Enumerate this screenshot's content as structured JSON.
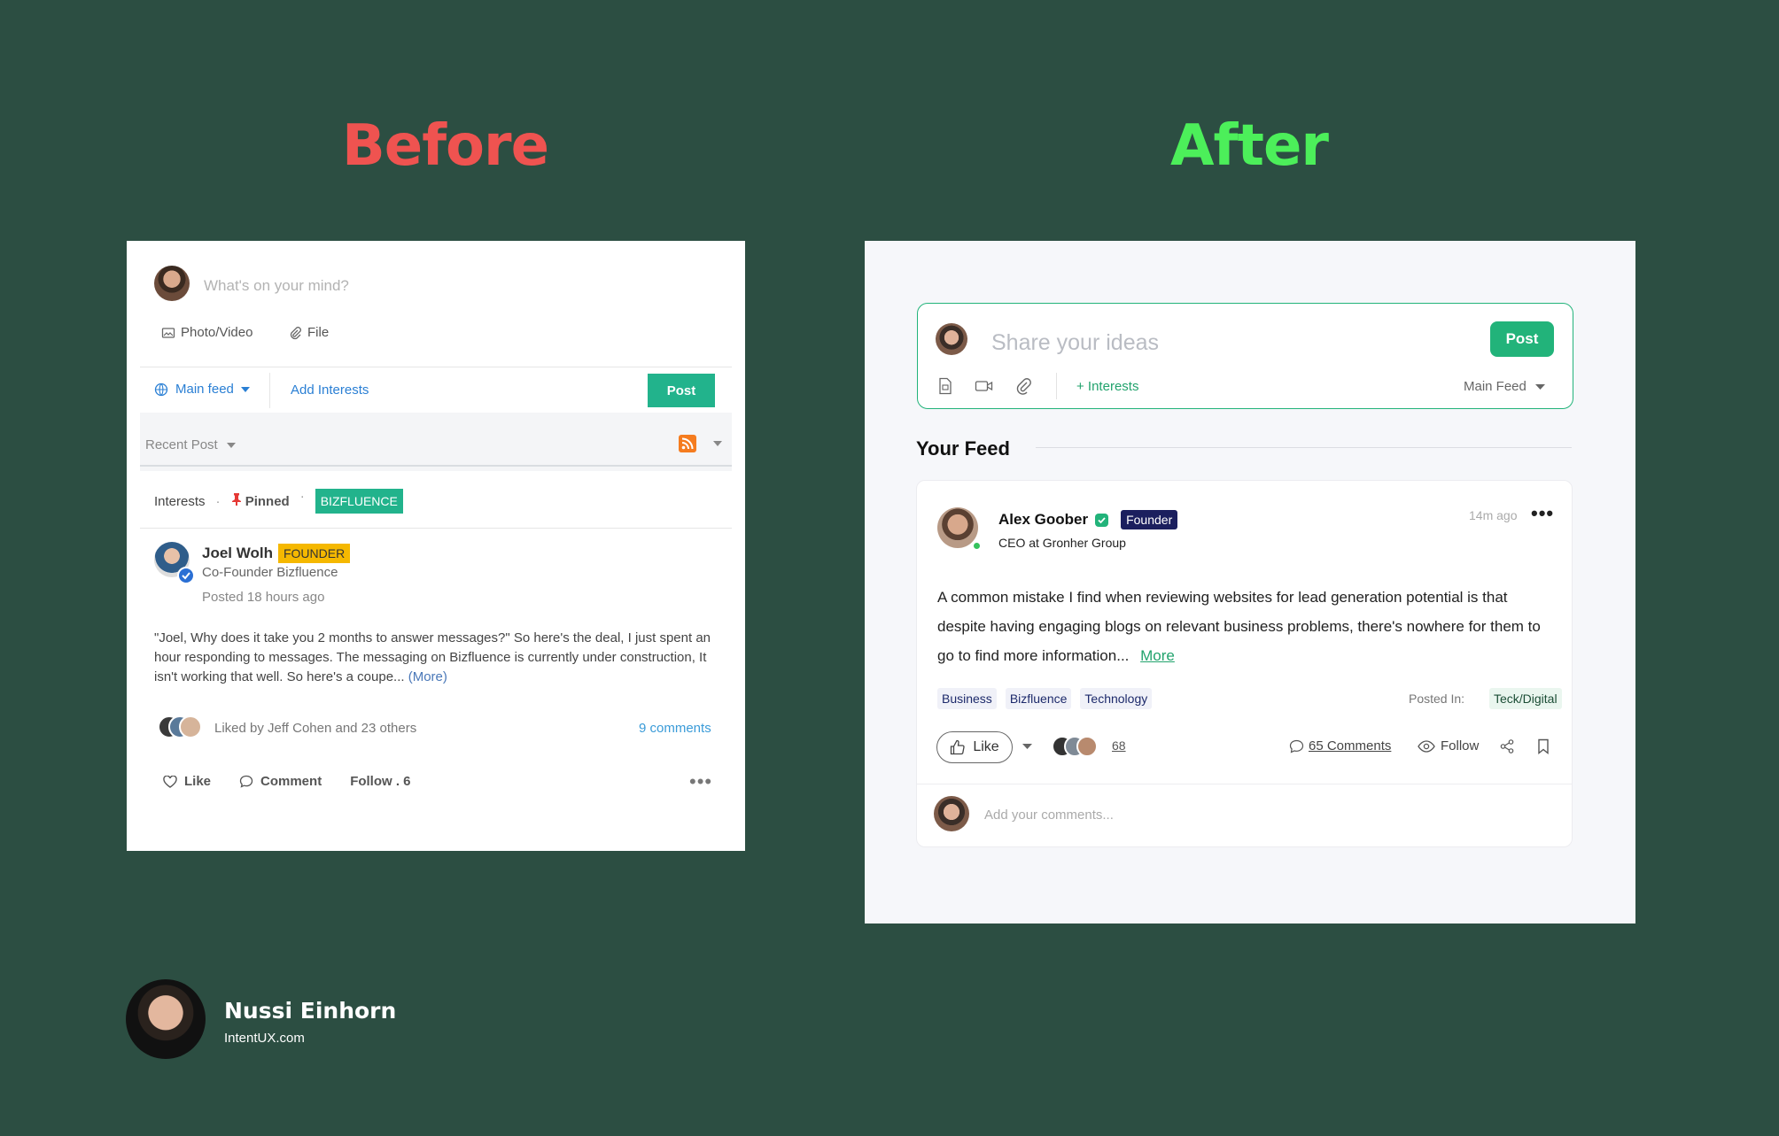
{
  "headings": {
    "before": "Before",
    "after": "After"
  },
  "before": {
    "composer": {
      "placeholder": "What's on your mind?",
      "photo_video": "Photo/Video",
      "file": "File",
      "main_feed": "Main feed",
      "add_interests": "Add Interests",
      "post": "Post"
    },
    "recent_post": "Recent Post",
    "post": {
      "interests": "Interests",
      "pinned": "Pinned",
      "tag": "BIZFLUENCE",
      "author": "Joel Wolh",
      "badge": "FOUNDER",
      "role": "Co-Founder Bizfluence",
      "posted": "Posted 18 hours ago",
      "body": "\"Joel, Why does it take you 2 months to answer messages?\" So here's the deal, I just spent an hour responding to messages. The messaging on Bizfluence is currently under construction, It isn't working that well. So here's a coupe...",
      "more": "(More)",
      "liked_by": "Liked by Jeff Cohen and 23 others",
      "comments": "9 comments",
      "like": "Like",
      "comment": "Comment",
      "follow": "Follow . 6"
    }
  },
  "after": {
    "composer": {
      "placeholder": "Share your ideas",
      "post": "Post",
      "interests": "+ Interests",
      "main_feed": "Main Feed"
    },
    "your_feed": "Your Feed",
    "post": {
      "author": "Alex Goober",
      "badge": "Founder",
      "role": "CEO at Gronher Group",
      "time": "14m ago",
      "body": "A common mistake I find when reviewing websites for lead generation potential is that despite having engaging blogs on relevant business problems, there's nowhere for them to go to find more information...",
      "more": "More",
      "tags": [
        "Business",
        "Bizfluence",
        "Technology"
      ],
      "posted_in_label": "Posted In:",
      "posted_in": "Teck/Digital",
      "like": "Like",
      "reactions": "68",
      "comments": "65 Comments",
      "follow": "Follow",
      "add_comment": "Add your comments..."
    }
  },
  "footer": {
    "name": "Nussi Einhorn",
    "site": "IntentUX.com"
  },
  "colors": {
    "background": "#2c4e42",
    "before_heading": "#ef5350",
    "after_heading": "#4cef5a",
    "accent_green": "#22b37a"
  }
}
